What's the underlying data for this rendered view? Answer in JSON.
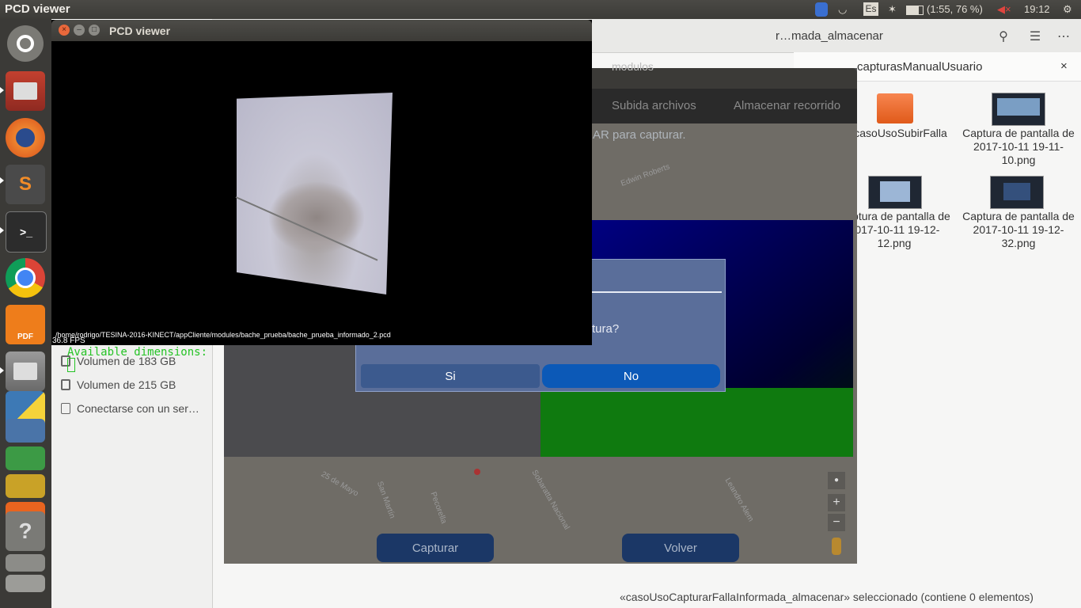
{
  "top_panel": {
    "active_app": "PCD viewer",
    "keyboard_layout": "Es",
    "battery": "(1:55, 76 %)",
    "clock": "19:12"
  },
  "launcher": {
    "items": [
      {
        "icon": "ubuntu-dash-icon"
      },
      {
        "icon": "files-icon"
      },
      {
        "icon": "firefox-icon"
      },
      {
        "icon": "sublime-text-icon",
        "glyph": "S"
      },
      {
        "icon": "terminal-icon",
        "glyph": ">_"
      },
      {
        "icon": "chrome-icon"
      },
      {
        "icon": "foxit-pdf-icon",
        "glyph": "PDF"
      },
      {
        "icon": "files-icon-2"
      },
      {
        "icon": "python-icon"
      },
      {
        "icon": "help-icon",
        "glyph": "?"
      }
    ]
  },
  "nautilus": {
    "path_segment": "r…mada_almacenar",
    "tab_title": "capturasManualUsuario",
    "tab_close": "×",
    "files": [
      {
        "name": "casoUsoSubirFalla",
        "kind": "folder"
      },
      {
        "name": "Captura de pantalla de 2017-10-11 19-11-10.png",
        "kind": "image"
      },
      {
        "name": "Captura de pantalla de 2017-10-11 19-12-12.png",
        "kind": "image"
      },
      {
        "name": "Captura de pantalla de 2017-10-11 19-12-32.png",
        "kind": "image"
      }
    ],
    "sidebar": {
      "items": [
        "Volumen de 183 GB",
        "Volumen de 215 GB",
        "Conectarse con un ser…"
      ]
    },
    "status": "«casoUsoCapturarFallaInformada_almacenar» seleccionado  (contiene 0 elementos)"
  },
  "app_window": {
    "title": "modulos",
    "menu": [
      "Subida archivos",
      "Almacenar recorrido"
    ],
    "hint": "AR para capturar.",
    "dialog": {
      "question": "tura?",
      "yes": "Si",
      "no": "No"
    },
    "buttons": {
      "capture": "Capturar",
      "back": "Volver"
    },
    "map_labels": [
      "Edwin Roberts",
      "25 de Mayo",
      "San Martín",
      "Pecorella",
      "Sobaratta Nacional",
      "Leandro Alem"
    ],
    "zoom": {
      "in": "+",
      "out": "−"
    }
  },
  "pcd_viewer": {
    "window_title": "PCD viewer",
    "file_path": "/home/rodrigo/TESINA-2016-KINECT/appCliente/modules/bache_prueba/bache_prueba_informado_2.pcd",
    "fps": "36.8 FPS",
    "console_text": "Available dimensions:"
  }
}
